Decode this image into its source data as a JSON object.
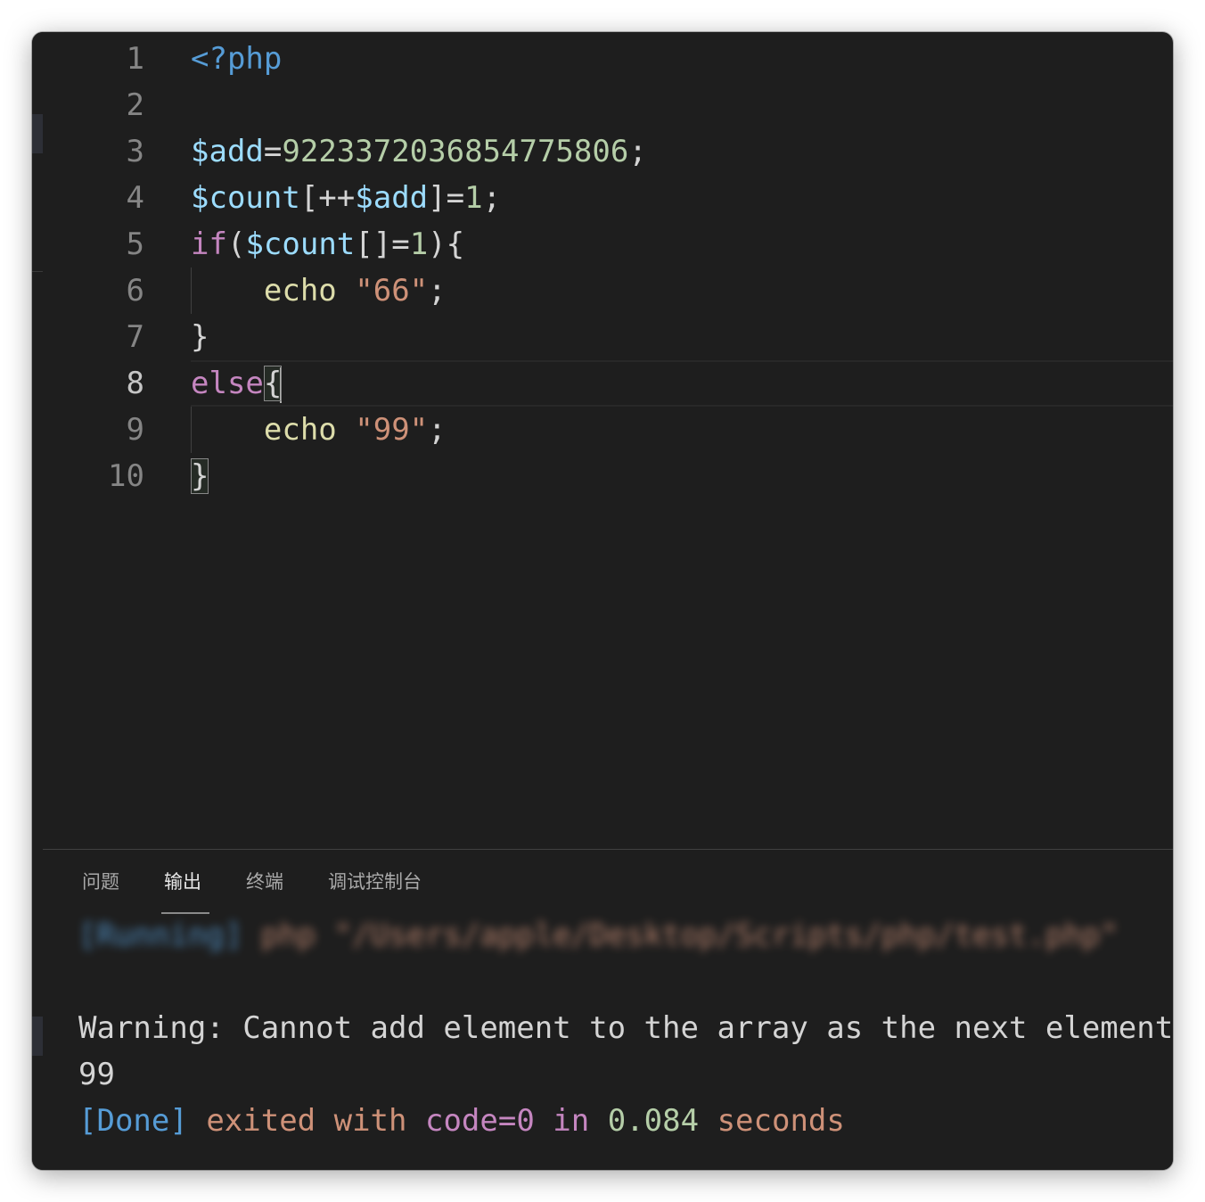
{
  "editor": {
    "line_numbers": [
      "1",
      "2",
      "3",
      "4",
      "5",
      "6",
      "7",
      "8",
      "9",
      "10"
    ],
    "active_line": "8",
    "lines": [
      [
        {
          "t": "<?php",
          "c": "tag"
        }
      ],
      [],
      [
        {
          "t": "$add",
          "c": "var"
        },
        {
          "t": "=",
          "c": "punc"
        },
        {
          "t": "9223372036854775806",
          "c": "num"
        },
        {
          "t": ";",
          "c": "punc"
        }
      ],
      [
        {
          "t": "$count",
          "c": "var"
        },
        {
          "t": "[++",
          "c": "punc"
        },
        {
          "t": "$add",
          "c": "var"
        },
        {
          "t": "]=",
          "c": "punc"
        },
        {
          "t": "1",
          "c": "num"
        },
        {
          "t": ";",
          "c": "punc"
        }
      ],
      [
        {
          "t": "if",
          "c": "kw"
        },
        {
          "t": "(",
          "c": "punc"
        },
        {
          "t": "$count",
          "c": "var"
        },
        {
          "t": "[]=",
          "c": "punc"
        },
        {
          "t": "1",
          "c": "num"
        },
        {
          "t": "){",
          "c": "punc"
        }
      ],
      [
        {
          "t": "    ",
          "c": "punc"
        },
        {
          "t": "echo",
          "c": "fn"
        },
        {
          "t": " ",
          "c": "punc"
        },
        {
          "t": "\"66\"",
          "c": "str"
        },
        {
          "t": ";",
          "c": "punc"
        }
      ],
      [
        {
          "t": "}",
          "c": "punc"
        }
      ],
      [
        {
          "t": "else",
          "c": "kw"
        },
        {
          "t": "{",
          "c": "punc",
          "box": true,
          "cursor": true
        }
      ],
      [
        {
          "t": "    ",
          "c": "punc"
        },
        {
          "t": "echo",
          "c": "fn"
        },
        {
          "t": " ",
          "c": "punc"
        },
        {
          "t": "\"99\"",
          "c": "str"
        },
        {
          "t": ";",
          "c": "punc"
        }
      ],
      [
        {
          "t": "}",
          "c": "punc",
          "box": true
        }
      ]
    ]
  },
  "panel": {
    "tabs": [
      {
        "label": "问题",
        "name": "tab-problems"
      },
      {
        "label": "输出",
        "name": "tab-output",
        "active": true
      },
      {
        "label": "终端",
        "name": "tab-terminal"
      },
      {
        "label": "调试控制台",
        "name": "tab-debug-console"
      }
    ],
    "output": {
      "running_tag": "[Running]",
      "running_cmd": "php \"/Users/apple/Desktop/Scripts/php/test.php\"",
      "warning": "Warning: Cannot add element to the array as the next element",
      "result": "99",
      "done_tag": "[Done]",
      "done_text": "exited with",
      "done_code": "code=0",
      "done_in": "in",
      "done_time": "0.084",
      "done_seconds": "seconds"
    }
  },
  "colors": {
    "background": "#1e1e1e",
    "keyword": "#c586c0",
    "variable": "#9cdcfe",
    "number": "#b5cea8",
    "string": "#ce9178",
    "function": "#dcdcaa",
    "tag": "#569cd6"
  }
}
